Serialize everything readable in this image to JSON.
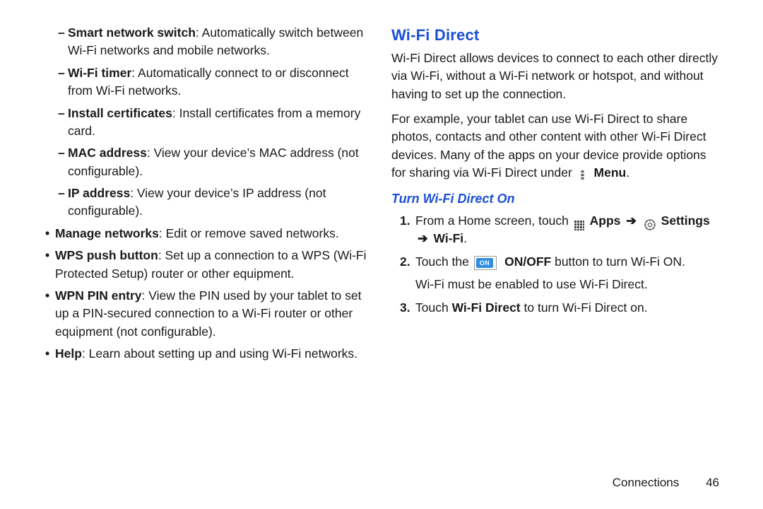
{
  "left": {
    "dash": [
      {
        "bold": "Smart network switch",
        "rest": ": Automatically switch between Wi-Fi networks and mobile networks."
      },
      {
        "bold": "Wi-Fi timer",
        "rest": ": Automatically connect to or disconnect from Wi-Fi networks."
      },
      {
        "bold": "Install certificates",
        "rest": ": Install certificates from a memory card."
      },
      {
        "bold": "MAC address",
        "rest": ": View your device’s MAC address (not configurable)."
      },
      {
        "bold": "IP address",
        "rest": ": View your device’s IP address (not configurable)."
      }
    ],
    "bul": [
      {
        "bold": "Manage networks",
        "rest": ": Edit or remove saved networks."
      },
      {
        "bold": "WPS push button",
        "rest": ": Set up a connection to a WPS (Wi-Fi Protected Setup) router or other equipment."
      },
      {
        "bold": "WPN PIN entry",
        "rest": ": View the PIN used by your tablet to set up a PIN-secured connection to a Wi-Fi router or other equipment (not configurable)."
      },
      {
        "bold": "Help",
        "rest": ": Learn about setting up and using Wi-Fi networks."
      }
    ]
  },
  "right": {
    "h2": "Wi-Fi Direct",
    "p1": "Wi-Fi Direct allows devices to connect to each other directly via Wi-Fi, without a Wi-Fi network or hotspot, and without having to set up the connection.",
    "p2a": "For example, your tablet can use Wi-Fi Direct to share photos, contacts and other content with other Wi-Fi Direct devices. Many of the apps on your device provide options for sharing via Wi-Fi Direct under ",
    "p2_menu_bold": "Menu",
    "p2_end": ".",
    "h3": "Turn Wi-Fi Direct On",
    "steps": {
      "s1": {
        "num": "1.",
        "lead": "From a Home screen, touch ",
        "apps_bold": "Apps",
        "settings_bold": "Settings",
        "arrow": "➔",
        "wifi_bold": "Wi-Fi",
        "end": "."
      },
      "s2": {
        "num": "2.",
        "lead": "Touch the ",
        "on_label": "ON",
        "onoff_bold": "ON/OFF",
        "rest": " button to turn Wi-Fi ON.",
        "line2": "Wi-Fi must be enabled to use Wi-Fi Direct."
      },
      "s3": {
        "num": "3.",
        "lead": "Touch ",
        "wfd_bold": "Wi-Fi Direct",
        "rest": " to turn Wi-Fi Direct on."
      }
    }
  },
  "footer": {
    "section": "Connections",
    "page": "46"
  }
}
